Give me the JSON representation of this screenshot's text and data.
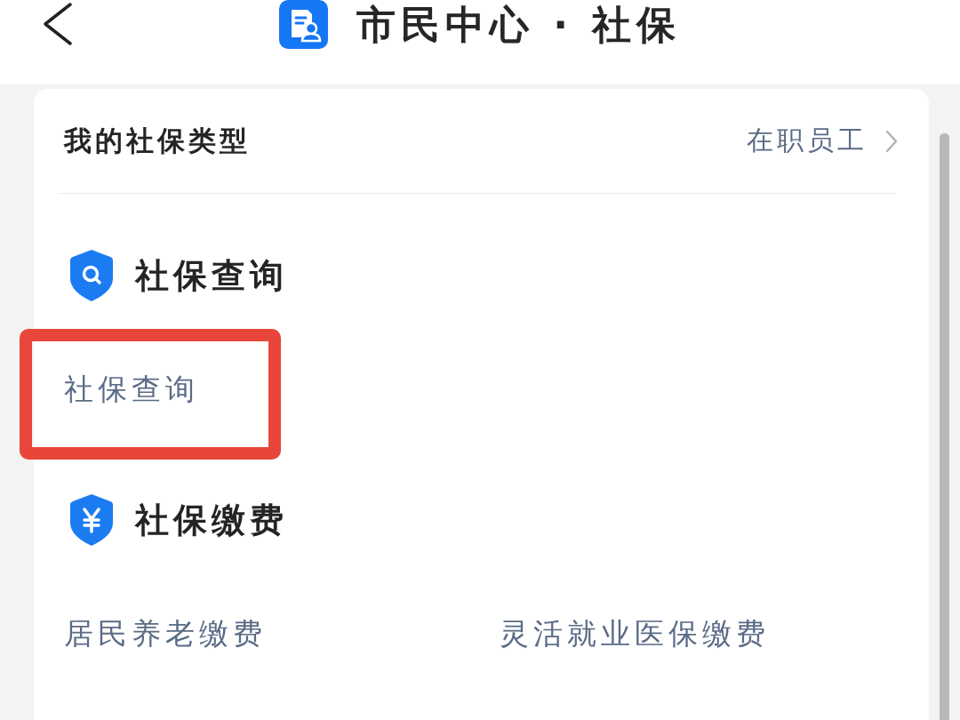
{
  "header": {
    "title": "市民中心 · 社保"
  },
  "insurance_type": {
    "label": "我的社保类型",
    "value": "在职员工"
  },
  "sections": [
    {
      "kind": "query",
      "title": "社保查询",
      "items": [
        {
          "label": "社保查询",
          "highlighted": true
        }
      ]
    },
    {
      "kind": "payment",
      "title": "社保缴费",
      "items": [
        {
          "label": "居民养老缴费",
          "highlighted": false
        },
        {
          "label": "灵活就业医保缴费",
          "highlighted": false
        }
      ]
    }
  ]
}
